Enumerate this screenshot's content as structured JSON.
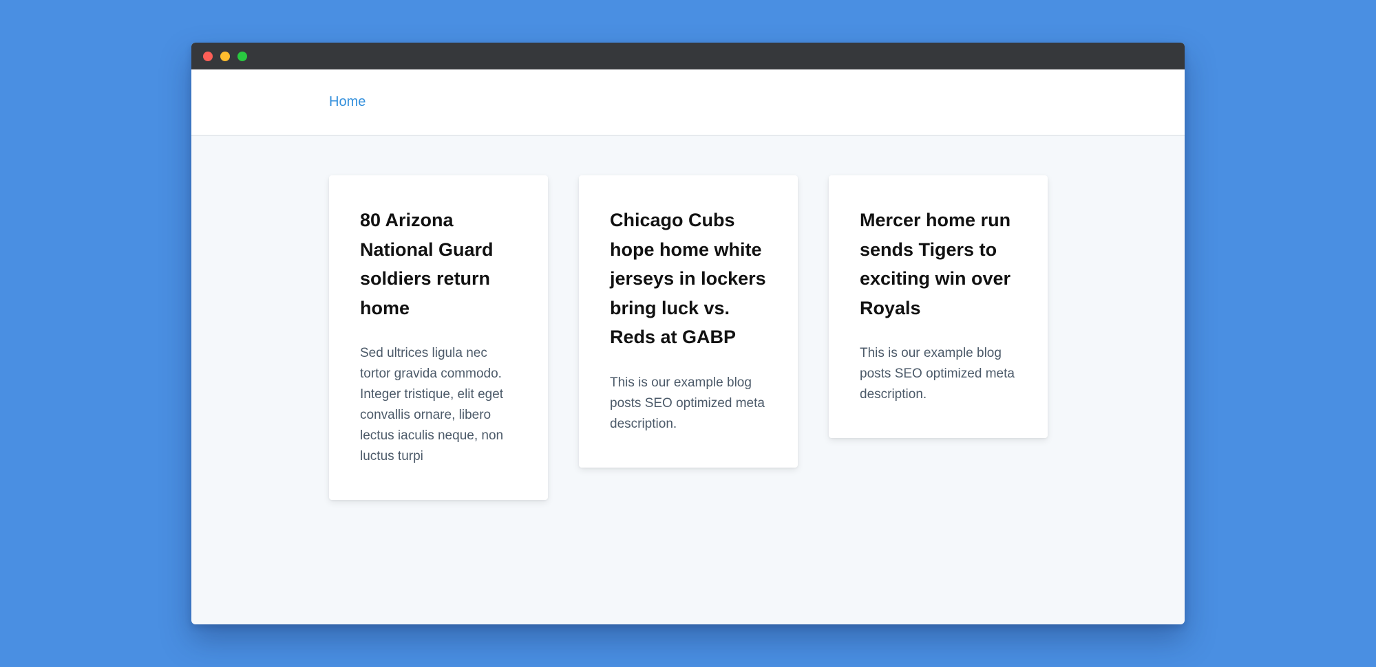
{
  "nav": {
    "home_label": "Home"
  },
  "posts": [
    {
      "title": "80 Arizona National Guard soldiers return home",
      "description": "Sed ultrices ligula nec tortor gravida commodo. Integer tristique, elit eget convallis ornare, libero lectus iaculis neque, non luctus turpi"
    },
    {
      "title": "Chicago Cubs hope home white jerseys in lockers bring luck vs. Reds at GABP",
      "description": "This is our example blog posts SEO optimized meta description."
    },
    {
      "title": "Mercer home run sends Tigers to exciting win over Royals",
      "description": "This is our example blog posts SEO optimized meta description."
    }
  ],
  "colors": {
    "background": "#4a8fe2",
    "titlebar": "#36383b",
    "link": "#3490dc",
    "content_bg": "#f5f8fb",
    "card_bg": "#ffffff",
    "title_text": "#111111",
    "body_text": "#4c5a69",
    "close_dot": "#fd5f57",
    "minimize_dot": "#febc2e",
    "zoom_dot": "#29c840"
  }
}
